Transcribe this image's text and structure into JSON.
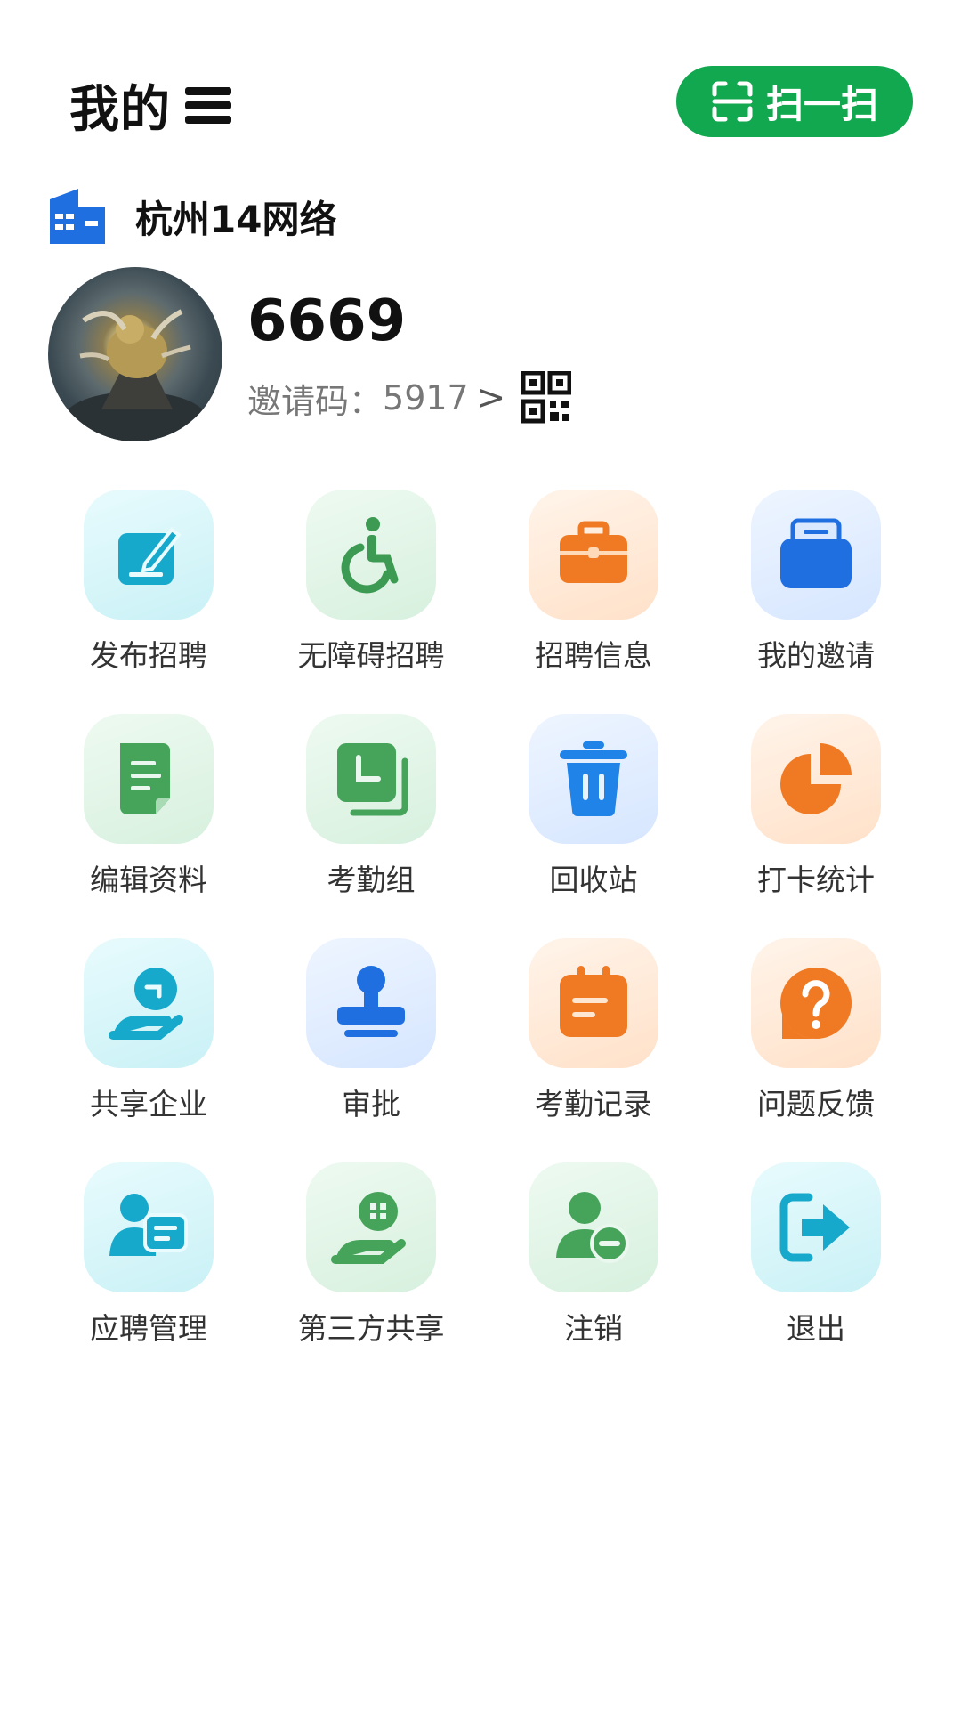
{
  "header": {
    "title": "我的",
    "scan_label": "扫一扫"
  },
  "company": {
    "name": "杭州14网络"
  },
  "profile": {
    "username": "6669",
    "invite_prefix": "邀请码：",
    "invite_code": "5917",
    "chevron": ">"
  },
  "menu": [
    {
      "label": "发布招聘",
      "icon": "edit-icon",
      "bg": "cyan"
    },
    {
      "label": "无障碍招聘",
      "icon": "wheelchair-icon",
      "bg": "green"
    },
    {
      "label": "招聘信息",
      "icon": "briefcase-icon",
      "bg": "orange"
    },
    {
      "label": "我的邀请",
      "icon": "inbox-icon",
      "bg": "blue"
    },
    {
      "label": "编辑资料",
      "icon": "document-icon",
      "bg": "green"
    },
    {
      "label": "考勤组",
      "icon": "layers-clock-icon",
      "bg": "green"
    },
    {
      "label": "回收站",
      "icon": "trash-icon",
      "bg": "blue"
    },
    {
      "label": "打卡统计",
      "icon": "pie-chart-icon",
      "bg": "orange"
    },
    {
      "label": "共享企业",
      "icon": "hand-share-icon",
      "bg": "cyan"
    },
    {
      "label": "审批",
      "icon": "stamp-icon",
      "bg": "blue"
    },
    {
      "label": "考勤记录",
      "icon": "calendar-icon",
      "bg": "orange"
    },
    {
      "label": "问题反馈",
      "icon": "question-icon",
      "bg": "orange"
    },
    {
      "label": "应聘管理",
      "icon": "user-chat-icon",
      "bg": "cyan"
    },
    {
      "label": "第三方共享",
      "icon": "hand-grid-icon",
      "bg": "green"
    },
    {
      "label": "注销",
      "icon": "user-remove-icon",
      "bg": "green"
    },
    {
      "label": "退出",
      "icon": "logout-icon",
      "bg": "cyan"
    }
  ]
}
